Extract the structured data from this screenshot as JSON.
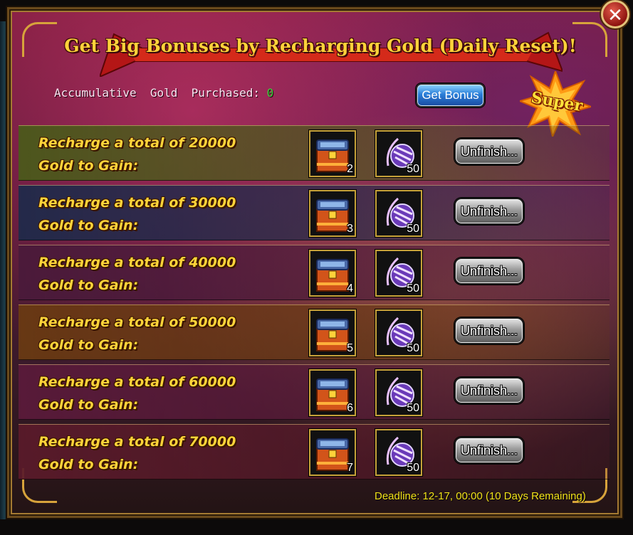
{
  "header": {
    "title": "Get Big Bonuses by Recharging Gold (Daily Reset)!",
    "close_icon": "close-icon"
  },
  "accumulative": {
    "label": "Accumulative  Gold  Purchased: ",
    "value": "0"
  },
  "get_bonus_label": "Get Bonus",
  "super_badge": "Super",
  "rows": [
    {
      "line1": "Recharge a total of 20000",
      "line2": "Gold to Gain:",
      "item1_qty": "2",
      "item2_qty": "50",
      "status": "Unfinish..."
    },
    {
      "line1": "Recharge a total of 30000",
      "line2": "Gold to Gain:",
      "item1_qty": "3",
      "item2_qty": "50",
      "status": "Unfinish..."
    },
    {
      "line1": "Recharge a total of 40000",
      "line2": "Gold to Gain:",
      "item1_qty": "4",
      "item2_qty": "50",
      "status": "Unfinish..."
    },
    {
      "line1": "Recharge a total of 50000",
      "line2": "Gold to Gain:",
      "item1_qty": "5",
      "item2_qty": "50",
      "status": "Unfinish..."
    },
    {
      "line1": "Recharge a total of 60000",
      "line2": "Gold to Gain:",
      "item1_qty": "6",
      "item2_qty": "50",
      "status": "Unfinish..."
    },
    {
      "line1": "Recharge a total of 70000",
      "line2": "Gold to Gain:",
      "item1_qty": "7",
      "item2_qty": "50",
      "status": "Unfinish..."
    }
  ],
  "row_colors": [
    "#4a5a1a",
    "#1e2a4a",
    "#4a1a3a",
    "#6a3a12",
    "#5a1a3a",
    "#5a1a2a"
  ],
  "reward_icons": [
    "treasure-chest-icon",
    "crystal-orb-icon"
  ],
  "deadline": "Deadline: 12-17, 00:00 (10 Days Remaining)"
}
